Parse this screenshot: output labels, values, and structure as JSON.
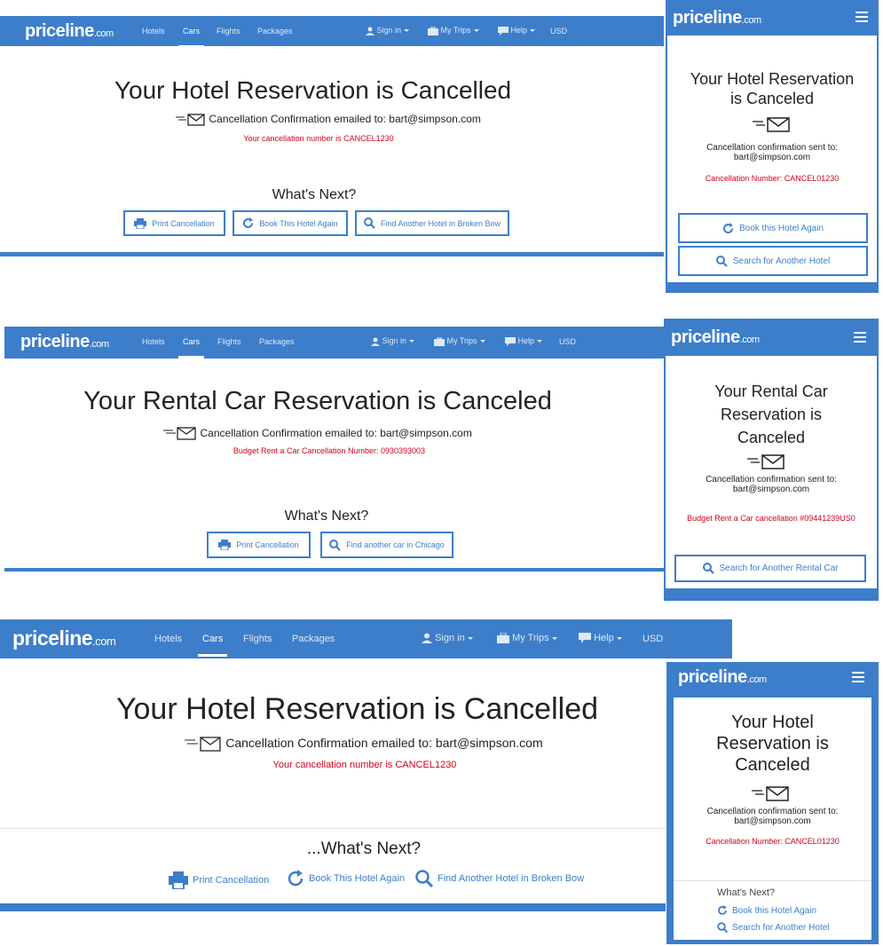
{
  "brand": {
    "name": "priceline",
    "suffix": ".com"
  },
  "nav": {
    "links": [
      "Hotels",
      "Cars",
      "Flights",
      "Packages"
    ],
    "active": "Cars",
    "sign_in": "Sign in",
    "my_trips": "My Trips",
    "help": "Help",
    "currency": "USD"
  },
  "panel1": {
    "title": "Your Hotel Reservation is Cancelled",
    "email_line": "Cancellation Confirmation emailed to: bart@simpson.com",
    "cancel_number": "Your cancellation number is CANCEL1230",
    "whats_next": "What's Next?",
    "buttons": [
      "Print Cancellation",
      "Book This Hotel Again",
      "Find Another Hotel in Broken Bow"
    ]
  },
  "mobile1": {
    "title_l1": "Your Hotel Reservation",
    "title_l2": "is Canceled",
    "sent_l1": "Cancellation confirmation sent to:",
    "sent_l2": "bart@simpson.com",
    "cancel_number": "Cancellation Number: CANCEL01230",
    "buttons": [
      "Book this Hotel Again",
      "Search for Another Hotel"
    ]
  },
  "panel2": {
    "title": "Your Rental Car Reservation is Canceled",
    "email_line": "Cancellation Confirmation emailed to: bart@simpson.com",
    "cancel_number": "Budget Rent a Car Cancellation Number: 0930393003",
    "whats_next": "What's Next?",
    "buttons": [
      "Print Cancellation",
      "Find another car in Chicago"
    ]
  },
  "mobile2": {
    "title_l1": "Your Rental Car",
    "title_l2": "Reservation is",
    "title_l3": "Canceled",
    "sent_l1": "Cancellation confirmation sent to:",
    "sent_l2": "bart@simpson.com",
    "cancel_number": "Budget Rent a Car cancellation #09441239US0",
    "buttons": [
      "Search for Another Rental Car"
    ]
  },
  "panel3": {
    "title": "Your Hotel Reservation is Cancelled",
    "email_line": "Cancellation Confirmation emailed to: bart@simpson.com",
    "cancel_number": "Your cancellation number is CANCEL1230",
    "whats_next": "...What's Next?",
    "links": [
      "Print Cancellation",
      "Book This Hotel Again",
      "Find Another Hotel in Broken Bow"
    ]
  },
  "mobile3": {
    "title_l1": "Your Hotel",
    "title_l2": "Reservation is",
    "title_l3": "Canceled",
    "sent_l1": "Cancellation confirmation sent to:",
    "sent_l2": "bart@simpson.com",
    "cancel_number": "Cancellation Number: CANCEL01230",
    "whats_next": "What's Next?",
    "links": [
      "Book this Hotel Again",
      "Search for Another Hotel"
    ]
  },
  "colors": {
    "brand_blue": "#3d7ecb",
    "alert_red": "#d0021b"
  }
}
